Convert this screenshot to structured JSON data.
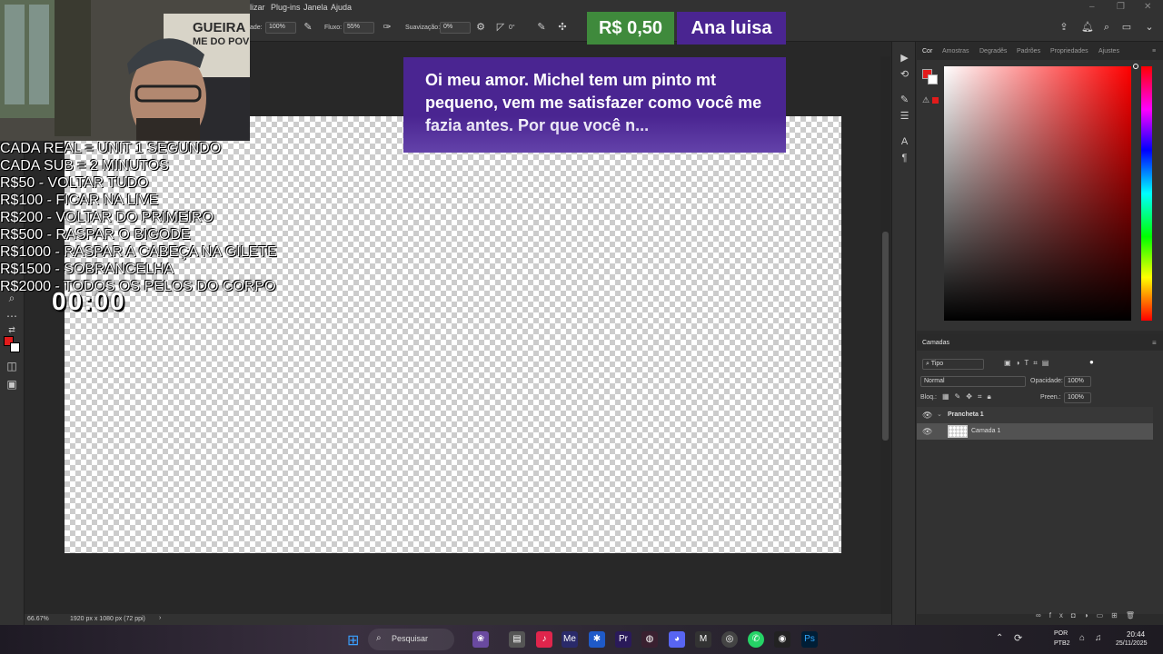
{
  "menu": {
    "items": [
      "lizar",
      "Plug-ins",
      "Janela",
      "Ajuda"
    ]
  },
  "options_bar": {
    "opacity_label": "ade:",
    "opacity_value": "100%",
    "flow_label": "Fluxo:",
    "flow_value": "55%",
    "smoothing_label": "Suavização:",
    "smoothing_value": "0%",
    "angle_value": "0°"
  },
  "overlay": {
    "price": "R$ 0,50",
    "donor_name": "Ana luisa",
    "message": "Oi meu amor. Michel tem um pinto mt pequeno, vem me satisfazer como você me fazia antes. Por que você n...",
    "webcam_sign": "GUEIRA",
    "webcam_sign_2": "ME DO POV",
    "list": [
      "CADA REAL = UNIT 1 SEGUNDO",
      "CADA SUB = 2 MINUTOS",
      "R$50 - VOLTAR TUDO",
      "R$100 - FICAR NA LIVE",
      "R$200 - VOLTAR DO PRIMEIRO",
      "R$500 - RASPAR O BIGODE",
      "R$1000 - RASPAR A CABEÇA NA GILETE",
      "R$1500 - SOBRANCELHA",
      "R$2000 - TODOS OS PELOS DO CORPO"
    ],
    "timer": "00:00"
  },
  "status": {
    "zoom": "66.67%",
    "doc_info": "1920 px x 1080 px (72 ppi)"
  },
  "color_panel": {
    "tabs": [
      "Cor",
      "Amostras",
      "Degradês",
      "Padrões",
      "Propriedades",
      "Ajustes"
    ],
    "foreground_color": "#e21b1b",
    "background_color": "#ffffff"
  },
  "layers_panel": {
    "title": "Camadas",
    "filter_label": "Tipo",
    "blend_mode": "Normal",
    "opacity_label": "Opacidade:",
    "opacity_value": "100%",
    "lock_label": "Bloq.:",
    "fill_label": "Preen.:",
    "fill_value": "100%",
    "layers": [
      {
        "name": "Prancheta 1",
        "kind": "artboard"
      },
      {
        "name": "Camada 1",
        "kind": "layer"
      }
    ]
  },
  "taskbar": {
    "search_placeholder": "Pesquisar",
    "lang": "POR",
    "lang_sub": "PTB2",
    "time": "20:44",
    "date": "25/11/2025"
  }
}
